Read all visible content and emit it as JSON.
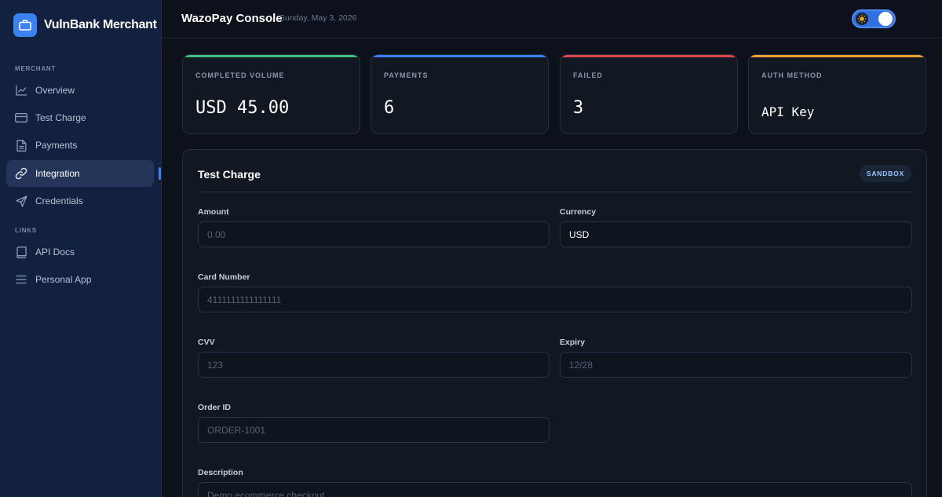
{
  "brand": {
    "name": "VulnBank Merchant",
    "icon": "briefcase-icon",
    "color": "#3b82f6"
  },
  "sidebar": {
    "sections": [
      {
        "title": "MERCHANT"
      },
      {
        "title": "LINKS"
      }
    ],
    "items": [
      {
        "label": "Overview",
        "icon": "chart-line-icon",
        "active": false
      },
      {
        "label": "Test Charge",
        "icon": "credit-card-icon",
        "active": false
      },
      {
        "label": "Payments",
        "icon": "document-icon",
        "active": false
      },
      {
        "label": "Integration",
        "icon": "link-icon",
        "active": true
      },
      {
        "label": "Credentials",
        "icon": "send-icon",
        "active": false
      },
      {
        "label": "API Docs",
        "icon": "book-icon",
        "active": false
      },
      {
        "label": "Personal App",
        "icon": "menu-icon",
        "active": false
      }
    ]
  },
  "header": {
    "title": "WazoPay Console",
    "date": "Sunday, May 3, 2026",
    "theme_toggle": {
      "icon": "sun-icon",
      "on": true
    }
  },
  "stats": [
    {
      "label": "COMPLETED VOLUME",
      "value": "USD 45.00",
      "accent": "#3fbf7f"
    },
    {
      "label": "PAYMENTS",
      "value": "6",
      "accent": "#3b82f6"
    },
    {
      "label": "FAILED",
      "value": "3",
      "accent": "#e0474c"
    },
    {
      "label": "AUTH METHOD",
      "value": "API Key",
      "accent": "#f0a030"
    }
  ],
  "form": {
    "title": "Test Charge",
    "badge": "SANDBOX",
    "fields": {
      "amount": {
        "label": "Amount",
        "value": "",
        "placeholder": "0.00"
      },
      "currency": {
        "label": "Currency",
        "value": "USD",
        "placeholder": ""
      },
      "card_number": {
        "label": "Card Number",
        "value": "",
        "placeholder": "4111111111111111"
      },
      "cvv": {
        "label": "CVV",
        "value": "",
        "placeholder": "123"
      },
      "expiry": {
        "label": "Expiry",
        "value": "",
        "placeholder": "12/28"
      },
      "order_id": {
        "label": "Order ID",
        "value": "",
        "placeholder": "ORDER-1001"
      },
      "description": {
        "label": "Description",
        "value": "",
        "placeholder": "Demo ecommerce checkout"
      }
    }
  }
}
